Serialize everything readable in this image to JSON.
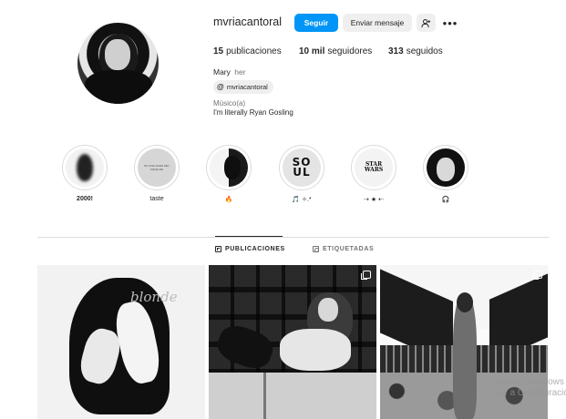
{
  "profile": {
    "username": "mvriacantoral",
    "follow_label": "Seguir",
    "message_label": "Enviar mensaje",
    "suggest_icon": "add-person-icon",
    "more_icon": "more-options-icon",
    "stats": {
      "posts_count": "15",
      "posts_label": "publicaciones",
      "followers_count": "10 mil",
      "followers_label": "seguidores",
      "following_count": "313",
      "following_label": "seguidos"
    },
    "full_name": "Mary",
    "pronouns": "her",
    "threads_handle": "mvriacantoral",
    "category": "Músico(a)",
    "bio": "I'm literally Ryan Gosling"
  },
  "highlights": [
    {
      "label": "2000!"
    },
    {
      "label": "taste"
    },
    {
      "label": "🔥"
    },
    {
      "label": "🎵 ✧.*"
    },
    {
      "label": "⇢ ★ ⇠"
    },
    {
      "label": "🎧"
    }
  ],
  "highlight_art": {
    "taste_text": "NO ONE MADE ME I MADE ME",
    "soul_text": "SO UL",
    "starwars_text": "STAR WARS"
  },
  "tabs": {
    "posts_label": "PUBLICACIONES",
    "tagged_label": "ETIQUETADAS"
  },
  "posts": [
    {
      "caption_art": "blonde",
      "multi": false
    },
    {
      "multi": true
    },
    {
      "multi": true
    }
  ],
  "watermark": {
    "line1": "Activar Windows",
    "line2": "Ve a Configuración para"
  },
  "colors": {
    "accent": "#0095f6",
    "secondary_button": "#efefef",
    "divider": "#dbdbdb"
  }
}
